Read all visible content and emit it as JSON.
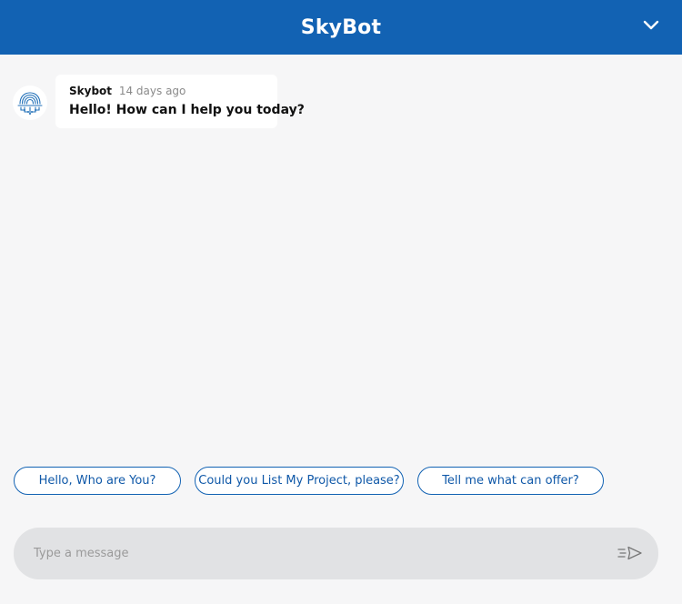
{
  "header": {
    "title": "SkyBot",
    "collapse_icon": "chevron-down-icon"
  },
  "colors": {
    "primary": "#1262b3",
    "background": "#f6f6f7",
    "input_background": "#e1e2e4"
  },
  "messages": [
    {
      "avatar_icon": "brain-circuit-icon",
      "sender": "Skybot",
      "time": "14 days ago",
      "text": "Hello! How can I help you today?"
    }
  ],
  "suggestions": [
    {
      "label": "Hello, Who are You?"
    },
    {
      "label": "Could you List My Project, please?"
    },
    {
      "label": "Tell me what can offer?"
    }
  ],
  "composer": {
    "placeholder": "Type a message",
    "value": "",
    "send_icon": "send-icon"
  }
}
